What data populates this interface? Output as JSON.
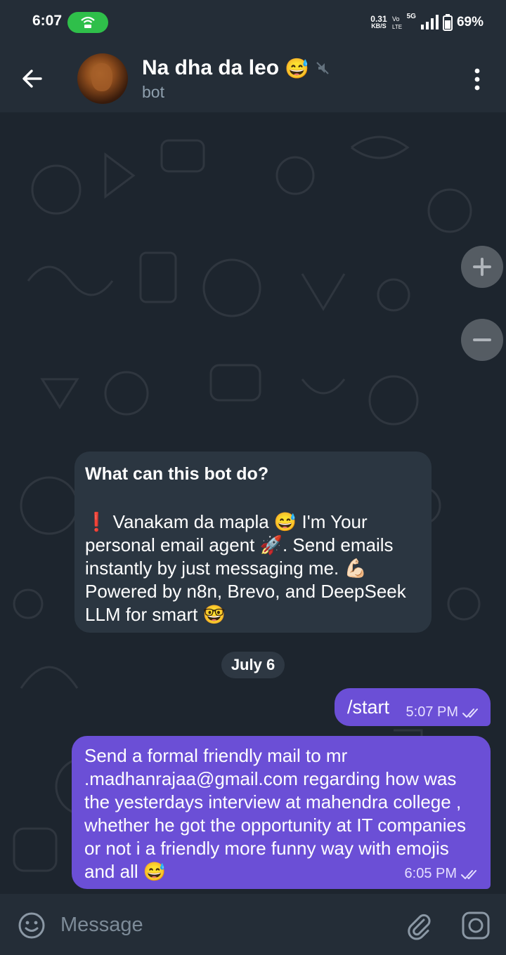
{
  "status_bar": {
    "time": "6:07",
    "speed_value": "0.31",
    "speed_unit": "KB/S",
    "network": "5G",
    "battery": "69%"
  },
  "header": {
    "title": "Na dha da leo",
    "title_emoji": "😅",
    "subtitle": "bot"
  },
  "bot_info": {
    "title": "What can this bot do?",
    "body": "❗ Vanakam da mapla 😅 I'm Your personal email agent 🚀. Send emails instantly by just messaging me. 💪🏻 Powered by n8n, Brevo, and DeepSeek LLM for smart 🤓"
  },
  "date_separator": "July 6",
  "messages": [
    {
      "text": "/start",
      "time": "5:07 PM",
      "status": "read"
    },
    {
      "text": "Send a formal friendly mail to mr .madhanrajaa@gmail.com regarding how was the yesterdays interview at mahendra college , whether he got the opportunity at IT companies or not i a friendly more funny way with emojis and all 😅",
      "time": "6:05 PM",
      "status": "read"
    }
  ],
  "input": {
    "placeholder": "Message"
  },
  "colors": {
    "header_bg": "#242d37",
    "chat_bg": "#1d252e",
    "outgoing_bubble": "#6b4fd6",
    "incoming_card": "#2b3641",
    "hotspot_green": "#2fbf4a"
  },
  "icons": [
    "hotspot-icon",
    "back-arrow-icon",
    "mute-icon",
    "more-vertical-icon",
    "zoom-in-icon",
    "zoom-out-icon",
    "double-check-icon",
    "emoji-icon",
    "attach-icon",
    "camera-icon"
  ]
}
